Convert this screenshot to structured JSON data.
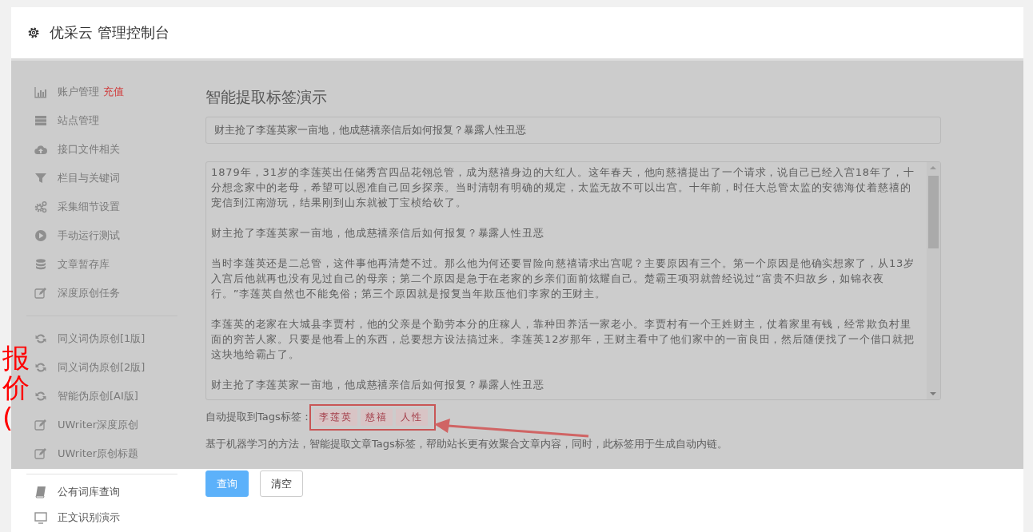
{
  "header": {
    "title": "优采云 管理控制台"
  },
  "sidebar": {
    "groups": [
      [
        {
          "label": "账户管理",
          "badge": "充值"
        },
        {
          "label": "站点管理"
        },
        {
          "label": "接口文件相关"
        },
        {
          "label": "栏目与关键词"
        },
        {
          "label": "采集细节设置"
        },
        {
          "label": "手动运行测试"
        },
        {
          "label": "文章暂存库"
        },
        {
          "label": "深度原创任务"
        }
      ],
      [
        {
          "label": "同义词伪原创[1版]"
        },
        {
          "label": "同义词伪原创[2版]"
        },
        {
          "label": "智能伪原创[AI版]"
        },
        {
          "label": "UWriter深度原创"
        },
        {
          "label": "UWriter原创标题"
        }
      ],
      [
        {
          "label": "公有词库查询"
        },
        {
          "label": "正文识别演示"
        }
      ]
    ]
  },
  "main": {
    "title": "智能提取标签演示",
    "title_input": {
      "value": "财主抢了李莲英家一亩地，他成慈禧亲信后如何报复？暴露人性丑恶"
    },
    "article": [
      "1879年，31岁的李莲英出任储秀宫四品花翎总管，成为慈禧身边的大红人。这年春天，他向慈禧提出了一个请求，说自己已经入宫18年了，十分想念家中的老母，希望可以恩准自己回乡探亲。当时清朝有明确的规定，太监无故不可以出宫。十年前，时任大总管太监的安德海仗着慈禧的宠信到江南游玩，结果刚到山东就被丁宝桢给砍了。",
      "财主抢了李莲英家一亩地，他成慈禧亲信后如何报复？暴露人性丑恶",
      "当时李莲英还是二总管，这件事他再清楚不过。那么他为何还要冒险向慈禧请求出宫呢？主要原因有三个。第一个原因是他确实想家了，从13岁入宫后他就再也没有见过自己的母亲；第二个原因是急于在老家的乡亲们面前炫耀自己。楚霸王项羽就曾经说过“富贵不归故乡，如锦衣夜行。”李莲英自然也不能免俗；第三个原因就是报复当年欺压他们李家的王财主。",
      "李莲英的老家在大城县李贾村，他的父亲是个勤劳本分的庄稼人，靠种田养活一家老小。李贾村有一个王姓财主，仗着家里有钱，经常欺负村里面的穷苦人家。只要是他看上的东西，总要想方设法搞过来。李莲英12岁那年，王财主看中了他们家中的一亩良田，然后随便找了一个借口就把这块地给霸占了。",
      "财主抢了李莲英家一亩地，他成慈禧亲信后如何报复？暴露人性丑恶"
    ],
    "tags_label": "自动提取到Tags标签：",
    "tags": [
      "李莲英",
      "慈禧",
      "人性"
    ],
    "description": "基于机器学习的方法，智能提取文章Tags标签，帮助站长更有效聚合文章内容，同时，此标签用于生成自动内链。",
    "buttons": [
      {
        "label": "查询",
        "kind": "primary"
      },
      {
        "label": "清空",
        "kind": "default"
      }
    ]
  },
  "annotation": {
    "text": "报价("
  }
}
